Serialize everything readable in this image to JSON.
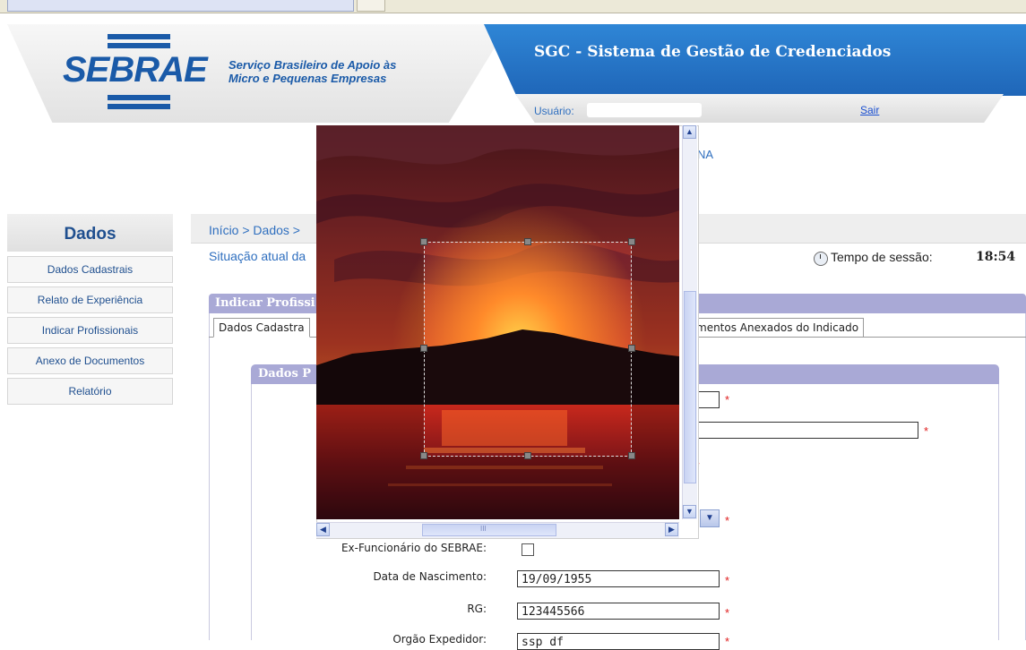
{
  "header": {
    "logo_text": "SEBRAE",
    "logo_subtitle_line1": "Serviço Brasileiro de Apoio às",
    "logo_subtitle_line2": "Micro e Pequenas Empresas",
    "app_title": "SGC - Sistema de Gestão de Credenciados",
    "user_label": "Usuário:",
    "logout_label": "Sair",
    "partial_text": "NA"
  },
  "sidebar": {
    "title": "Dados",
    "items": [
      {
        "label": "Dados Cadastrais"
      },
      {
        "label": "Relato de Experiência"
      },
      {
        "label": "Indicar Profissionais"
      },
      {
        "label": "Anexo de Documentos"
      },
      {
        "label": "Relatório"
      }
    ]
  },
  "main": {
    "breadcrumb": "Início > Dados >",
    "status_text": "Situação atual da",
    "session_label": "Tempo de sessão:",
    "session_value": "18:54",
    "panel_title": "Indicar Profissi",
    "tabs": [
      {
        "label": "Dados Cadastra"
      },
      {
        "label": "mentos Anexados do Indicado"
      }
    ],
    "subpanel_title": "Dados P"
  },
  "form": {
    "required_mark": "*",
    "ex_funcionario_label": "Ex-Funcionário do SEBRAE:",
    "birth_label": "Data de Nascimento:",
    "birth_value": "19/09/1955",
    "rg_label": "RG:",
    "rg_value": "123445566",
    "orgao_label": "Orgão Expedidor:",
    "orgao_value": "ssp df",
    "select_arrow": "▼"
  },
  "crop_dialog": {
    "image_description": "sunset-photo",
    "hscroll_grip": "III"
  },
  "colors": {
    "brand_blue": "#1a5aa8",
    "title_blue": "#1f66b8",
    "panel_header": "#a9a9d6",
    "required_red": "#e02020"
  }
}
